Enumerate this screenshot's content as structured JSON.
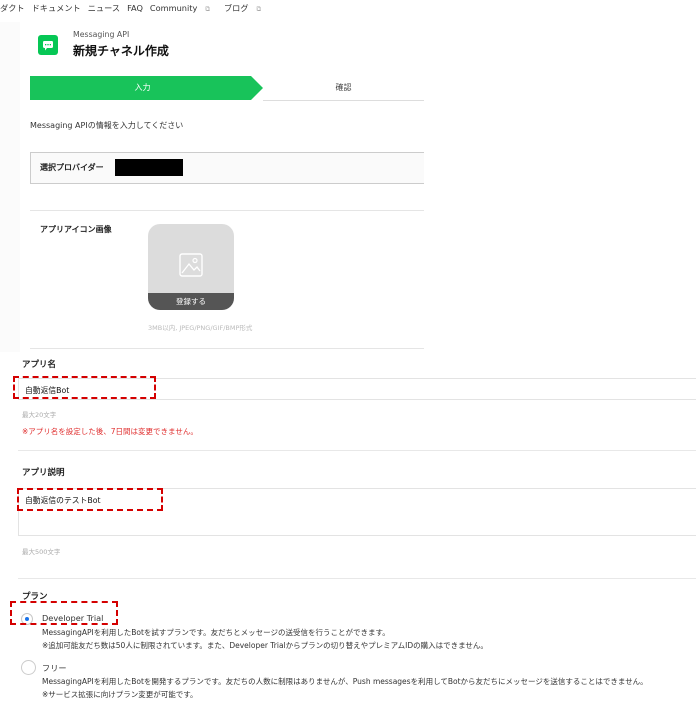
{
  "nav": {
    "items": [
      {
        "label": "ダクト",
        "external": false
      },
      {
        "label": "ドキュメント",
        "external": false
      },
      {
        "label": "ニュース",
        "external": false
      },
      {
        "label": "FAQ",
        "external": false
      },
      {
        "label": "Community",
        "external": true
      },
      {
        "label": "ブログ",
        "external": true
      }
    ],
    "external_glyph": "⧉"
  },
  "header": {
    "kicker": "Messaging API",
    "title": "新規チャネル作成",
    "icon": "chat-bubble-icon",
    "icon_color": "#06c755"
  },
  "steps": {
    "input": "入力",
    "confirm": "確認",
    "active_color": "#18c35a"
  },
  "description": "Messaging APIの情報を入力してください",
  "provider": {
    "label": "選択プロバイダー",
    "value": ""
  },
  "app_icon": {
    "label": "アプリアイコン画像",
    "button": "登録する",
    "hint": "3MB以内, JPEG/PNG/GIF/BMP形式",
    "icon": "image-placeholder-icon"
  },
  "app_name": {
    "label": "アプリ名",
    "value": "自動返信Bot",
    "hint": "最大20文字",
    "warning": "※アプリ名を設定した後、7日間は変更できません。"
  },
  "app_desc": {
    "label": "アプリ説明",
    "value": "自動返信のテストBot",
    "hint": "最大500文字"
  },
  "plan": {
    "label": "プラン",
    "options": [
      {
        "name": "Developer Trial",
        "selected": true,
        "lines": [
          "MessagingAPIを利用したBotを試すプランです。友だちとメッセージの送受信を行うことができます。",
          "※追加可能友だち数は50人に制限されています。また、Developer Trialからプランの切り替えやプレミアムIDの購入はできません。"
        ]
      },
      {
        "name": "フリー",
        "selected": false,
        "lines": [
          "MessagingAPIを利用したBotを開発するプランです。友だちの人数に制限はありませんが、Push messagesを利用してBotから友だちにメッセージを送信することはできません。",
          "※サービス拡張に向けプラン変更が可能です。"
        ]
      }
    ]
  },
  "colors": {
    "highlight": "#d40000",
    "warning": "#e02e2e",
    "radio_selected": "#1a73e8"
  }
}
